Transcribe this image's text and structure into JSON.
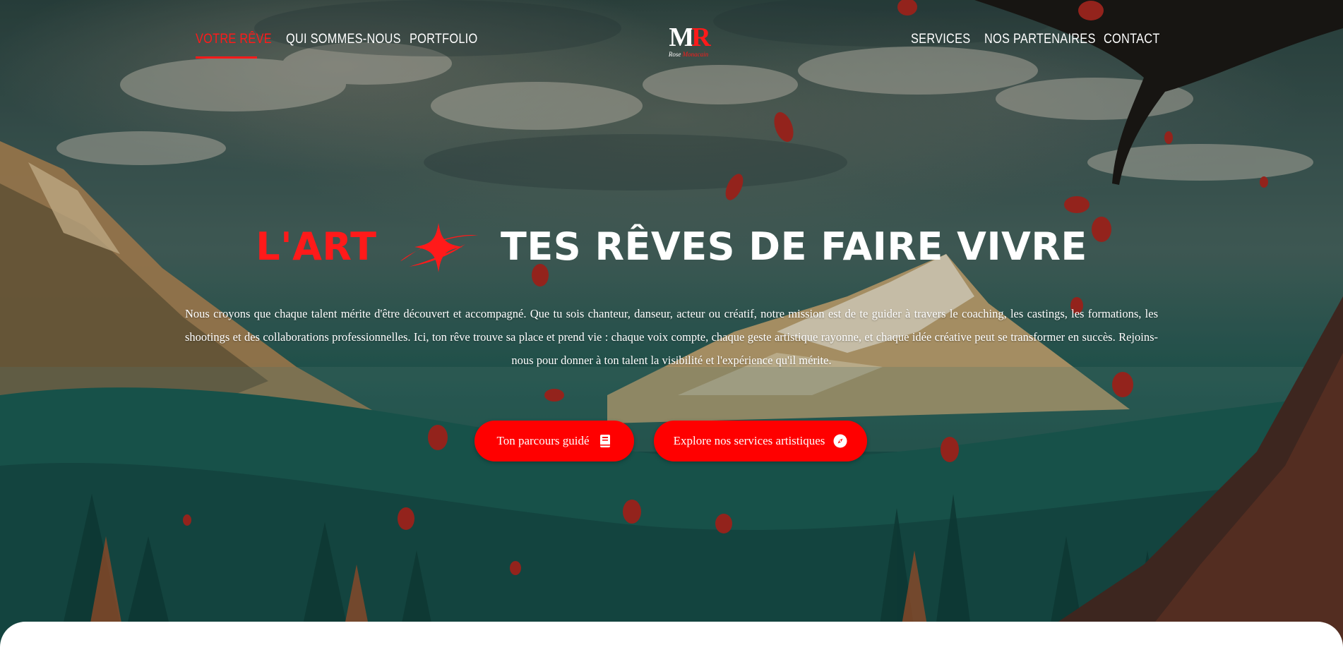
{
  "nav": {
    "left": [
      {
        "label": "VOTRE RÊVE",
        "active": true
      },
      {
        "label": "QUI SOMMES-NOUS",
        "active": false
      },
      {
        "label": "PORTFOLIO",
        "active": false
      }
    ],
    "right": [
      {
        "label": "SERVICES"
      },
      {
        "label": "NOS PARTENAIRES"
      },
      {
        "label": "CONTACT"
      }
    ],
    "logo": {
      "mark_m": "M",
      "mark_r": "R",
      "script_1": "Rose",
      "script_2": "Monacain"
    }
  },
  "hero": {
    "title_red": "L'ART",
    "title_white": "TES RÊVES DE FAIRE VIVRE",
    "text": "Nous croyons que chaque talent mérite d'être découvert et accompagné. Que tu sois chanteur, danseur, acteur ou créatif, notre mission est de te guider à travers le coaching, les castings, les formations, les shootings et des collaborations professionnelles. Ici, ton rêve trouve sa place et prend vie : chaque voix compte, chaque geste artistique rayonne, et chaque idée créative peut se transformer en succès. Rejoins-nous pour donner à ton talent la visibilité et l'expérience qu'il mérite.",
    "buttons": [
      {
        "label": "Ton parcours guidé",
        "icon": "book-icon"
      },
      {
        "label": "Explore nos services artistiques",
        "icon": "compass-icon"
      }
    ]
  },
  "colors": {
    "accent": "#ff1a1a",
    "button": "#ff0000",
    "text": "#ffffff"
  }
}
